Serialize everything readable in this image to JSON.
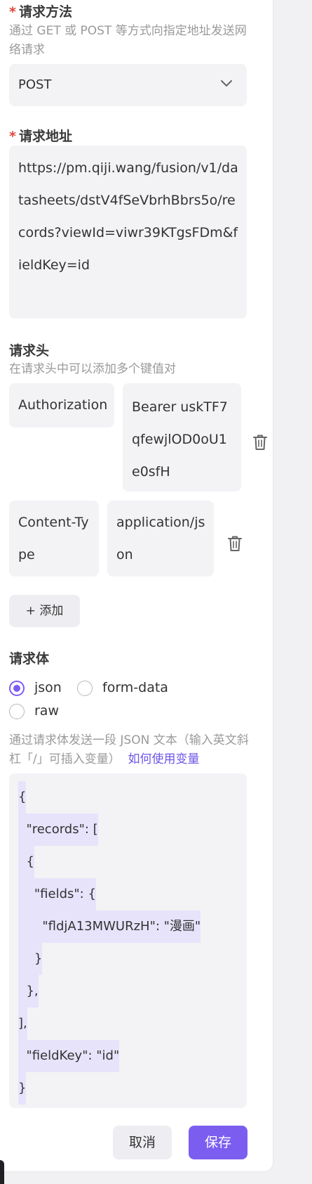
{
  "method_section": {
    "required_mark": "*",
    "title": "请求方法",
    "description": "通过 GET 或 POST 等方式向指定地址发送网络请求",
    "selected": "POST"
  },
  "url_section": {
    "required_mark": "*",
    "title": "请求地址",
    "value": "https://pm.qiji.wang/fusion/v1/datasheets/dstV4fSeVbrhBbrs5o/records?viewId=viwr39KTgsFDm&fieldKey=id"
  },
  "headers_section": {
    "title": "请求头",
    "description": "在请求头中可以添加多个键值对",
    "rows": [
      {
        "key": "Authorization",
        "value": "Bearer uskTF7qfewjlOD0oU1e0sfH"
      },
      {
        "key": "Content-Type",
        "value": "application/json"
      }
    ],
    "add_label": "+ 添加"
  },
  "body_section": {
    "title": "请求体",
    "options": [
      {
        "label": "json",
        "selected": true
      },
      {
        "label": "form-data",
        "selected": false
      },
      {
        "label": "raw",
        "selected": false
      }
    ],
    "description": "通过请求体发送一段 JSON 文本（输入英文斜杠「/」可插入变量）",
    "help_link": "如何使用变量",
    "code_lines": [
      "{",
      "  \"records\": [",
      "  {",
      "    \"fields\": {",
      "      \"fldjA13MWURzH\": \"漫画\"",
      "    }",
      "  },",
      "],",
      "  \"fieldKey\": \"id\"",
      "}"
    ]
  },
  "footer": {
    "cancel": "取消",
    "save": "保存"
  },
  "colors": {
    "accent": "#7b5ef0",
    "required": "#e0453b",
    "field_bg": "#f3f3f6",
    "code_highlight": "#e7e3fb"
  }
}
